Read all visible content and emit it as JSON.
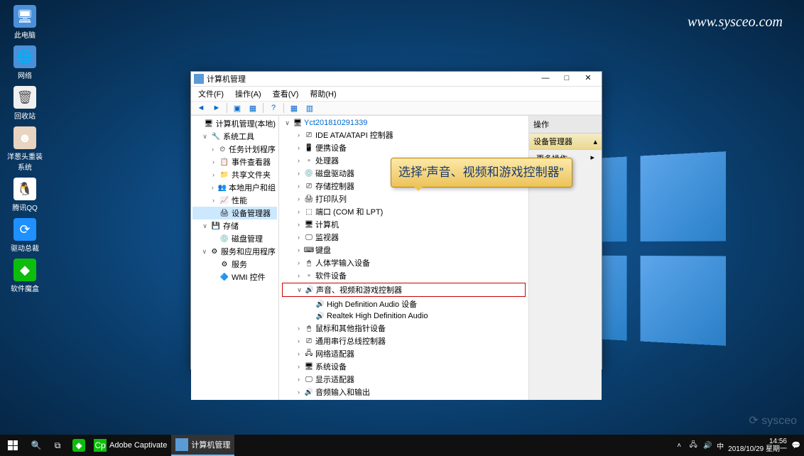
{
  "watermark": "www.sysceo.com",
  "corner_brand": "⟳ sysceo",
  "desktop": [
    {
      "label": "此电脑"
    },
    {
      "label": "网络"
    },
    {
      "label": "回收站"
    },
    {
      "label": "洋葱头重装系统"
    },
    {
      "label": "腾讯QQ"
    },
    {
      "label": "驱动总裁"
    },
    {
      "label": "软件魔盒"
    }
  ],
  "window": {
    "title": "计算机管理",
    "menu": {
      "file": "文件(F)",
      "action": "操作(A)",
      "view": "查看(V)",
      "help": "帮助(H)"
    },
    "left_tree": {
      "root": "计算机管理(本地)",
      "sys_tools": "系统工具",
      "task_scheduler": "任务计划程序",
      "event_viewer": "事件查看器",
      "shared_folders": "共享文件夹",
      "local_users": "本地用户和组",
      "performance": "性能",
      "device_manager": "设备管理器",
      "storage": "存储",
      "disk_mgmt": "磁盘管理",
      "services_apps": "服务和应用程序",
      "services": "服务",
      "wmi": "WMI 控件"
    },
    "devices": {
      "root": "Yct201810291339",
      "ide": "IDE ATA/ATAPI 控制器",
      "portable": "便携设备",
      "processors": "处理器",
      "disk_drives": "磁盘驱动器",
      "storage_ctrl": "存储控制器",
      "print_queues": "打印队列",
      "ports": "端口 (COM 和 LPT)",
      "computer": "计算机",
      "monitors": "监视器",
      "keyboards": "键盘",
      "hid": "人体学输入设备",
      "sw_dev": "软件设备",
      "sound": "声音、视频和游戏控制器",
      "hda": "High Definition Audio 设备",
      "realtek": "Realtek High Definition Audio",
      "mice": "鼠标和其他指针设备",
      "usb": "通用串行总线控制器",
      "network": "网络适配器",
      "system": "系统设备",
      "display": "显示适配器",
      "audio_io": "音频输入和输出"
    },
    "actions": {
      "header": "操作",
      "section": "设备管理器",
      "more": "更多操作"
    }
  },
  "callout": "选择“声音、视频和游戏控制器”",
  "taskbar": {
    "captivate": "Adobe Captivate",
    "compmgmt": "计算机管理",
    "ime": "中",
    "time": "14:56",
    "date": "2018/10/29 星期一"
  }
}
